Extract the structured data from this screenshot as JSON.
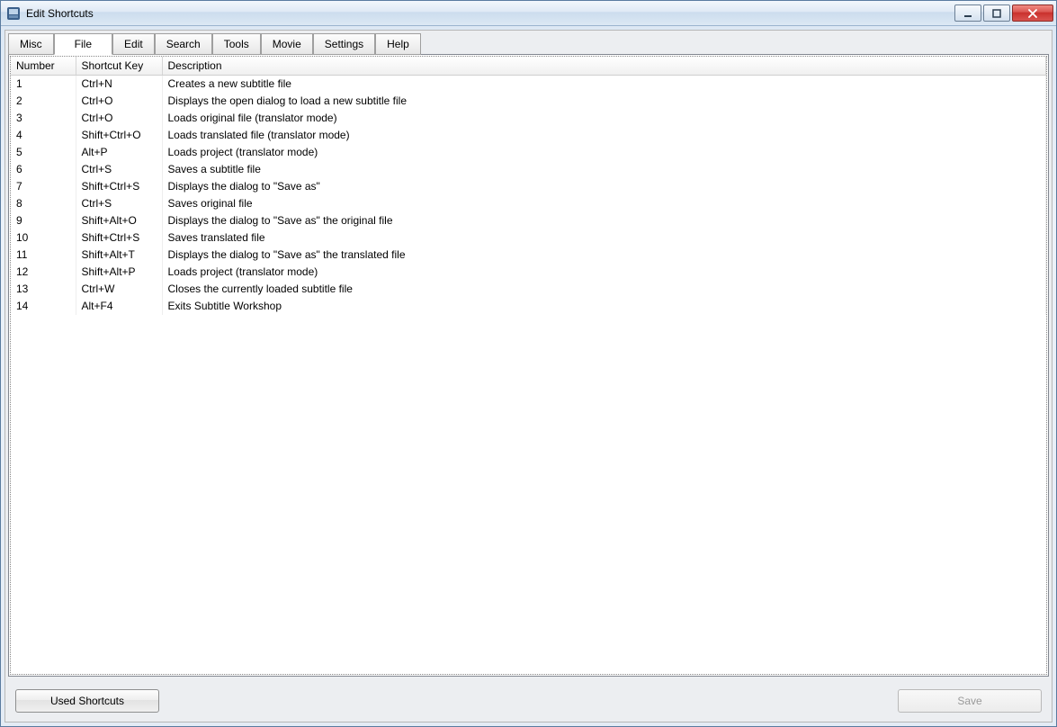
{
  "window": {
    "title": "Edit Shortcuts"
  },
  "tabs": [
    {
      "label": "Misc",
      "active": false
    },
    {
      "label": "File",
      "active": true
    },
    {
      "label": "Edit",
      "active": false
    },
    {
      "label": "Search",
      "active": false
    },
    {
      "label": "Tools",
      "active": false
    },
    {
      "label": "Movie",
      "active": false
    },
    {
      "label": "Settings",
      "active": false
    },
    {
      "label": "Help",
      "active": false
    }
  ],
  "columns": {
    "number": "Number",
    "shortcut": "Shortcut Key",
    "description": "Description"
  },
  "rows": [
    {
      "number": "1",
      "shortcut": "Ctrl+N",
      "description": "Creates a new subtitle file"
    },
    {
      "number": "2",
      "shortcut": "Ctrl+O",
      "description": "Displays the open dialog to load a new subtitle file"
    },
    {
      "number": "3",
      "shortcut": "Ctrl+O",
      "description": "Loads original file (translator mode)"
    },
    {
      "number": "4",
      "shortcut": "Shift+Ctrl+O",
      "description": "Loads translated file (translator mode)"
    },
    {
      "number": "5",
      "shortcut": "Alt+P",
      "description": "Loads project (translator mode)"
    },
    {
      "number": "6",
      "shortcut": "Ctrl+S",
      "description": "Saves a subtitle file"
    },
    {
      "number": "7",
      "shortcut": "Shift+Ctrl+S",
      "description": "Displays the dialog to \"Save as\""
    },
    {
      "number": "8",
      "shortcut": "Ctrl+S",
      "description": "Saves original file"
    },
    {
      "number": "9",
      "shortcut": "Shift+Alt+O",
      "description": "Displays the dialog to \"Save as\" the original file"
    },
    {
      "number": "10",
      "shortcut": "Shift+Ctrl+S",
      "description": "Saves translated file"
    },
    {
      "number": "11",
      "shortcut": "Shift+Alt+T",
      "description": "Displays the dialog to \"Save as\" the translated file"
    },
    {
      "number": "12",
      "shortcut": "Shift+Alt+P",
      "description": "Loads project (translator mode)"
    },
    {
      "number": "13",
      "shortcut": "Ctrl+W",
      "description": "Closes the currently loaded subtitle file"
    },
    {
      "number": "14",
      "shortcut": "Alt+F4",
      "description": "Exits Subtitle Workshop"
    }
  ],
  "buttons": {
    "used_shortcuts": "Used Shortcuts",
    "save": "Save"
  }
}
